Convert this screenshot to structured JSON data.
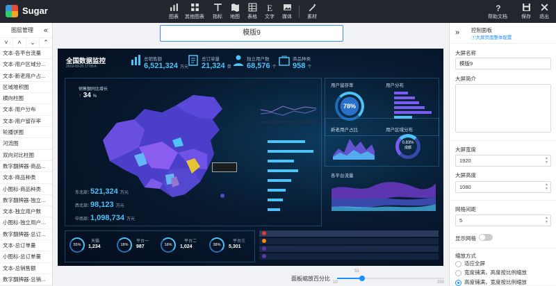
{
  "app": {
    "name": "Sugar"
  },
  "toolbar": {
    "items": [
      {
        "label": "图表",
        "icon": "bar-chart-icon"
      },
      {
        "label": "其他图表",
        "icon": "grid-chart-icon"
      },
      {
        "label": "指标",
        "icon": "text-metric-icon"
      },
      {
        "label": "地图",
        "icon": "map-icon"
      },
      {
        "label": "表格",
        "icon": "table-icon"
      },
      {
        "label": "文字",
        "icon": "text-icon"
      },
      {
        "label": "媒体",
        "icon": "image-icon"
      },
      {
        "label": "素材",
        "icon": "wand-icon"
      }
    ],
    "right": [
      {
        "label": "帮助文档",
        "icon": "help-icon"
      },
      {
        "label": "保存",
        "icon": "save-icon"
      },
      {
        "label": "退出",
        "icon": "close-icon"
      }
    ]
  },
  "layers": {
    "title": "图层管理",
    "items": [
      "文本-各平台流量",
      "文本-用户区域分...",
      "文本-新老用户占...",
      "区域堆积图",
      "横向柱图",
      "文本-用户分布",
      "文本-用户留存率",
      "轮播饼图",
      "河流图",
      "双向对比柱图",
      "数字翻牌器-商品...",
      "文本-商品种类",
      "小图标-商品种类",
      "数字翻牌器-独立...",
      "文本-独立用户数",
      "小图标-独立用户...",
      "数字翻牌器-总订...",
      "文本-总订单量",
      "小图标-总订单量",
      "文本-总销售额",
      "数字翻牌器-总销..."
    ]
  },
  "canvas": {
    "title_value": "模版9"
  },
  "screen": {
    "title": "全国数据监控",
    "date": "2019-03-20 17:05:4",
    "stats": [
      {
        "label": "总销售额",
        "value": "6,521,324",
        "unit": "万元"
      },
      {
        "label": "总订单量",
        "value": "21,324",
        "unit": "单"
      },
      {
        "label": "独立用户数",
        "value": "68,576",
        "unit": "个"
      },
      {
        "label": "商品种类",
        "value": "958",
        "unit": "个"
      }
    ],
    "map_growth_label": "销售额同比增长",
    "map_growth_value": "34",
    "map_growth_unit": "%",
    "regions": [
      {
        "label": "东北部：",
        "value": "521,324",
        "unit": "万元"
      },
      {
        "label": "西北部：",
        "value": "98,123",
        "unit": "万元"
      },
      {
        "label": "中南部：",
        "value": "1,098,734",
        "unit": "万元"
      }
    ],
    "retention_title": "用户留存率",
    "retention_value": "78%",
    "distribution_title": "用户分布",
    "newold_title": "新老用户占比",
    "region_dist_title": "用户区域分布",
    "region_dist_value": "0.83%",
    "region_dist_label": "成都",
    "flow_title": "各平台流量",
    "kpis": [
      {
        "pct": "55%",
        "name": "天猫",
        "value": "1,234"
      },
      {
        "pct": "18%",
        "name": "平台一",
        "value": "987"
      },
      {
        "pct": "18%",
        "name": "平台二",
        "value": "1,024"
      },
      {
        "pct": "38%",
        "name": "平台三",
        "value": "5,301"
      }
    ]
  },
  "scale": {
    "label": "面板缩放百分比",
    "value": "55",
    "min": "10",
    "max": "200",
    "fraction": 0.237
  },
  "panel": {
    "title": "控制面板",
    "subtitle": "①大屏页面整体配置",
    "name_label": "大屏名称",
    "name_value": "模版9",
    "desc_label": "大屏简介",
    "width_label": "大屏宽度",
    "width_value": "1920",
    "height_label": "大屏高度",
    "height_value": "1080",
    "grid_label": "网格间距",
    "grid_value": "5",
    "show_grid_label": "显示网格",
    "scale_mode_label": "缩放方式",
    "scale_options": [
      "适应全屏",
      "宽度铺满，高度按比例缩放",
      "高度铺满，宽度按比例缩放"
    ]
  },
  "colors": {
    "accent": "#1890ff",
    "topbar": "#23262e",
    "screen_bg": "#071a30",
    "cyan": "#4fc3f7",
    "purple": "#7b5cf0"
  }
}
